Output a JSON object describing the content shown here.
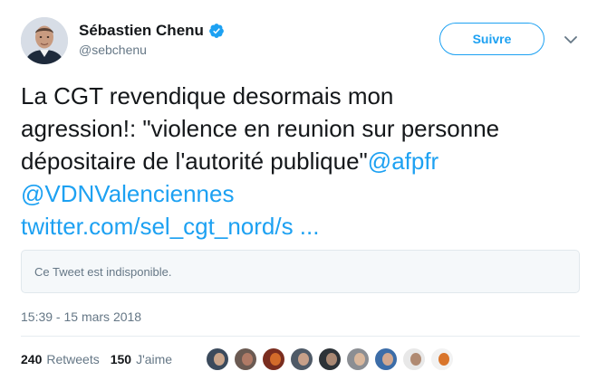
{
  "author": {
    "name": "Sébastien Chenu",
    "handle": "@sebchenu",
    "verified": true,
    "avatar_icon": "person-avatar-icon"
  },
  "header": {
    "follow_label": "Suivre",
    "menu_icon": "chevron-down-icon"
  },
  "tweet": {
    "text_line1": "La CGT revendique desormais mon",
    "text_line2": "agression!: \"violence en reunion sur personne",
    "text_line3": "dépositaire de l'autorité publique\"",
    "mention1": "@afpfr",
    "mention2": "@VDNValenciennes",
    "link": "twitter.com/sel_cgt_nord/s ...",
    "quoted_unavailable": "Ce Tweet est indisponible.",
    "timestamp": "15:39 - 15 mars 2018"
  },
  "stats": {
    "retweets_count": "240",
    "retweets_label": "Retweets",
    "likes_count": "150",
    "likes_label": "J'aime"
  },
  "likers": [
    {
      "bg": "#3b4a5c",
      "face": "#c9a48a"
    },
    {
      "bg": "#6b5a52",
      "face": "#b07a66"
    },
    {
      "bg": "#7a2d1f",
      "face": "#d36b2a"
    },
    {
      "bg": "#4f5a67",
      "face": "#c7a089"
    },
    {
      "bg": "#2d3338",
      "face": "#a98873"
    },
    {
      "bg": "#8b8e93",
      "face": "#d9b79c"
    },
    {
      "bg": "#3c6da8",
      "face": "#d2a890"
    },
    {
      "bg": "#e8e8e8",
      "face": "#b08a72"
    },
    {
      "bg": "#f2f2f2",
      "face": "#d9752b"
    }
  ],
  "colors": {
    "accent": "#1da1f2",
    "text": "#14171a",
    "muted": "#657786"
  }
}
